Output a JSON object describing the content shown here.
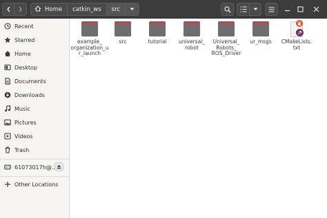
{
  "headerbar": {
    "breadcrumbs": [
      {
        "label": "Home",
        "icon": "home-icon"
      },
      {
        "label": "catkin_ws"
      },
      {
        "label": "src"
      }
    ]
  },
  "sidebar": {
    "places": [
      {
        "label": "Recent",
        "icon": "clock-icon"
      },
      {
        "label": "Starred",
        "icon": "star-icon"
      },
      {
        "label": "Home",
        "icon": "home-icon"
      },
      {
        "label": "Desktop",
        "icon": "desktop-icon"
      },
      {
        "label": "Documents",
        "icon": "document-icon"
      },
      {
        "label": "Downloads",
        "icon": "download-icon"
      },
      {
        "label": "Music",
        "icon": "music-icon"
      },
      {
        "label": "Pictures",
        "icon": "picture-icon"
      },
      {
        "label": "Videos",
        "icon": "video-icon"
      },
      {
        "label": "Trash",
        "icon": "trash-icon"
      }
    ],
    "devices": [
      {
        "label": "61073017h@...",
        "icon": "drive-icon"
      }
    ],
    "other": {
      "label": "Other Locations",
      "icon": "plus-icon"
    }
  },
  "files": [
    {
      "name": "example_ organization_ur_launch",
      "type": "folder"
    },
    {
      "name": "src",
      "type": "folder"
    },
    {
      "name": "tutorial",
      "type": "folder"
    },
    {
      "name": "universal_ robot",
      "type": "folder"
    },
    {
      "name": "Universal_ Robots_ ROS_Driver",
      "type": "folder"
    },
    {
      "name": "ur_msgs",
      "type": "folder"
    },
    {
      "name": "CMakeLists. txt",
      "type": "text-file-link"
    }
  ],
  "colors": {
    "headerbar": "#3c3c3c",
    "sidebar": "#f6f5f4",
    "folder_body": "#6e6e6e",
    "folder_tab": "#a8525c",
    "accent_orange": "#e95420",
    "link_badge": "#6d3a5c"
  }
}
